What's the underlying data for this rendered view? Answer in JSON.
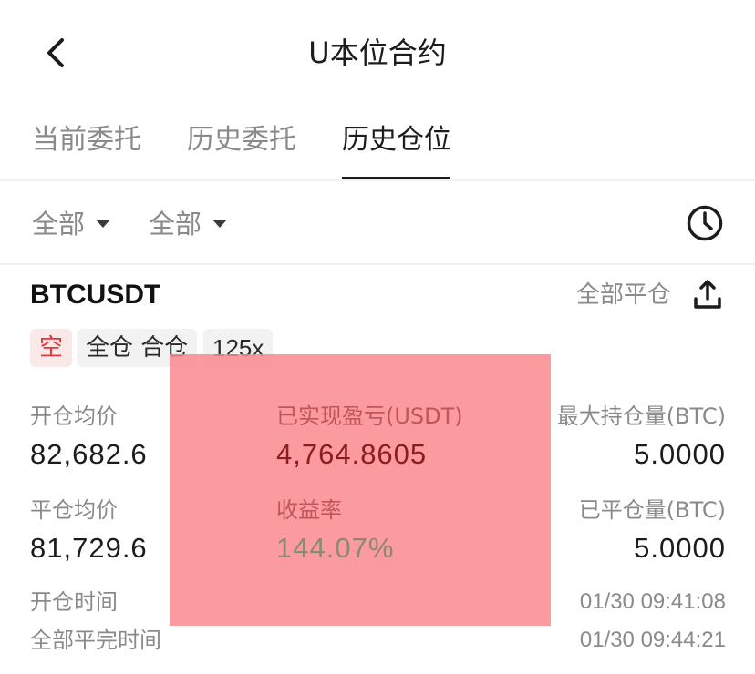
{
  "header": {
    "title": "U本位合约"
  },
  "tabs": [
    {
      "label": "当前委托",
      "active": false
    },
    {
      "label": "历史委托",
      "active": false
    },
    {
      "label": "历史仓位",
      "active": true
    }
  ],
  "filters": [
    {
      "label": "全部"
    },
    {
      "label": "全部"
    }
  ],
  "position": {
    "symbol": "BTCUSDT",
    "close_all_label": "全部平仓",
    "tags": {
      "side": "空",
      "mode": "全仓 合仓",
      "leverage": "125x"
    },
    "open_avg_label": "开仓均价",
    "open_avg_value": "82,682.6",
    "realized_pnl_label": "已实现盈亏(USDT)",
    "realized_pnl_value": "4,764.8605",
    "max_position_label": "最大持仓量(BTC)",
    "max_position_value": "5.0000",
    "close_avg_label": "平仓均价",
    "close_avg_value": "81,729.6",
    "roi_label": "收益率",
    "roi_value": "144.07%",
    "closed_qty_label": "已平仓量(BTC)",
    "closed_qty_value": "5.0000",
    "open_time_label": "开仓时间",
    "open_time_value": "01/30 09:41:08",
    "close_time_label": "全部平完时间",
    "close_time_value": "01/30 09:44:21"
  },
  "colors": {
    "short_red": "#e4393c",
    "overlay": "#fb8a8e"
  }
}
